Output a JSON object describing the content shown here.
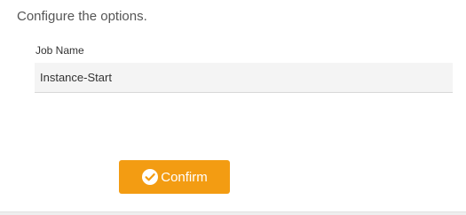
{
  "form": {
    "heading": "Configure the options.",
    "job_name_label": "Job Name",
    "job_name_value": "Instance-Start"
  },
  "actions": {
    "confirm_label": "Confirm",
    "confirm_icon": "check-circle-icon",
    "accent_color": "#f39c12"
  }
}
